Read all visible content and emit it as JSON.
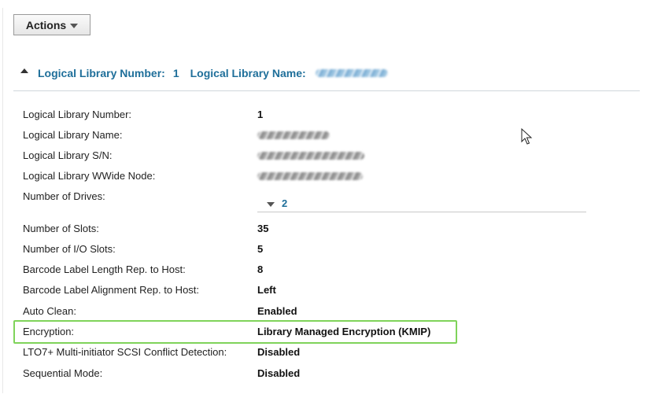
{
  "toolbar": {
    "actions_label": "Actions"
  },
  "section": {
    "number_label": "Logical Library Number:",
    "number_value": "1",
    "name_label": "Logical Library Name:"
  },
  "details": {
    "logical_library_number": {
      "label": "Logical Library Number:",
      "value": "1"
    },
    "logical_library_name": {
      "label": "Logical Library Name:"
    },
    "logical_library_sn": {
      "label": "Logical Library S/N:"
    },
    "logical_library_wwide_node": {
      "label": "Logical Library WWide Node:"
    },
    "number_of_drives": {
      "label": "Number of Drives:",
      "value": "2"
    },
    "number_of_slots": {
      "label": "Number of Slots:",
      "value": "35"
    },
    "number_of_io_slots": {
      "label": "Number of I/O Slots:",
      "value": "5"
    },
    "barcode_length": {
      "label": "Barcode Label Length Rep. to Host:",
      "value": "8"
    },
    "barcode_alignment": {
      "label": "Barcode Label Alignment Rep. to Host:",
      "value": "Left"
    },
    "auto_clean": {
      "label": "Auto Clean:",
      "value": "Enabled"
    },
    "encryption": {
      "label": "Encryption:",
      "value": "Library Managed Encryption (KMIP)"
    },
    "lto7_conflict": {
      "label": "LTO7+ Multi-initiator SCSI Conflict Detection:",
      "value": "Disabled"
    },
    "sequential_mode": {
      "label": "Sequential Mode:",
      "value": "Disabled"
    }
  },
  "colors": {
    "link_blue": "#1f6f9a",
    "highlight_green": "#7fd35a"
  },
  "icons": {
    "actions_caret": "caret-down-icon",
    "section_caret": "caret-up-icon",
    "drives_caret": "caret-down-icon",
    "cursor": "mouse-pointer-icon"
  }
}
